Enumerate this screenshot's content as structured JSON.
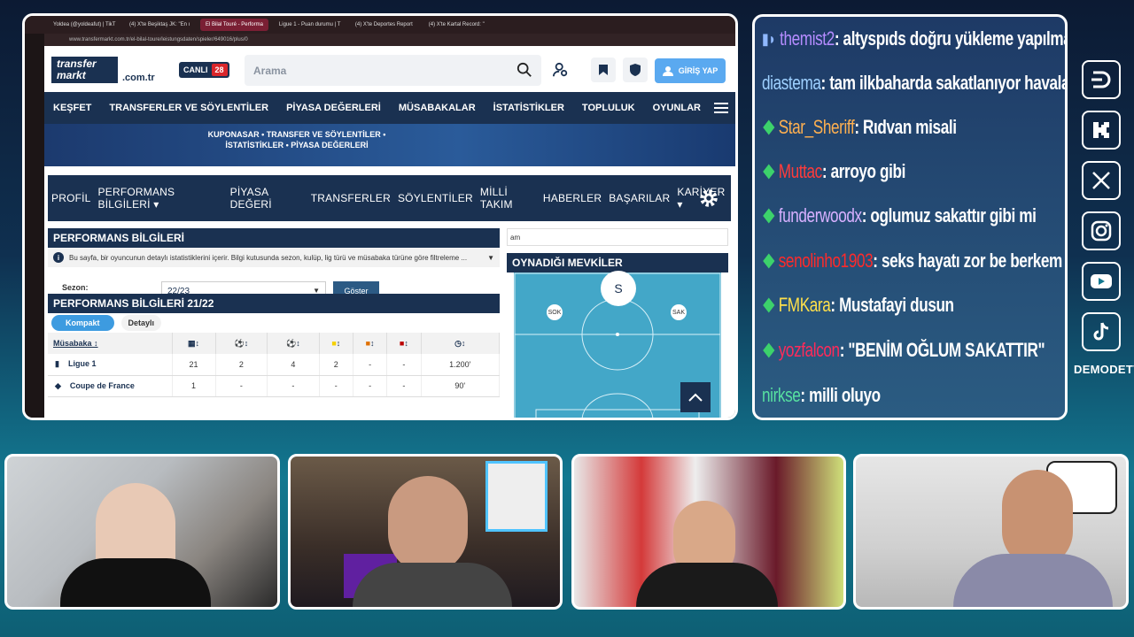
{
  "browser": {
    "tabs": [
      "Yoldea (@yoldeafut) | TikT",
      "(4) X'te Beşiktaş JK: \"En ı",
      "El Bilal Touré - Performa",
      "Ligue 1 - Puan durumu | T",
      "(4) X'te Deportes Report",
      "(4) X'te Kartal Record: \""
    ],
    "url": "www.transfermarkt.com.tr/el-bilal-toure/leistungsdaten/spieler/649016/plus/0"
  },
  "site": {
    "logo_line1": "transfer",
    "logo_line2": "markt",
    "logo_suffix": ".com.tr",
    "canli_label": "CANLI",
    "canli_count": "28",
    "search_placeholder": "Arama",
    "login_label": "GİRİŞ YAP",
    "nav": [
      "KEŞFET",
      "TRANSFERLER VE SÖYLENTİLER",
      "PİYASA DEĞERLERİ",
      "MÜSABAKALAR",
      "İSTATİSTİKLER",
      "TOPLULUK",
      "OYUNLAR"
    ],
    "banner_text": "KUPONASAR • TRANSFER VE SÖYLENTİLER • İSTATİSTİKLER • PİYASA DEĞERLERİ",
    "subnav": [
      "PROFİL",
      "PERFORMANS BİLGİLERİ ▾",
      "PİYASA DEĞERİ",
      "TRANSFERLER",
      "SÖYLENTİLER",
      "MİLLİ TAKIM",
      "HABERLER",
      "BAŞARILAR",
      "KARİYER ▾"
    ],
    "perf_title": "PERFORMANS BİLGİLERİ",
    "info_text": "Bu sayfa, bir oyuncunun detaylı istatistiklerini içerir. Bilgi kutusunda sezon, kulüp, lig türü ve müsabaka türüne göre filtreleme ...",
    "sezon_label": "Sezon:",
    "sezon_value": "22/23",
    "goster_label": "Göster",
    "perf_title2": "PERFORMANS BİLGİLERİ 21/22",
    "tab_kompakt": "Kompakt",
    "tab_detayli": "Detaylı",
    "table_header_first": "Müsabaka",
    "rows": [
      {
        "comp": "Ligue 1",
        "c1": "21",
        "c2": "2",
        "c3": "4",
        "c4": "2",
        "c5": "-",
        "c6": "-",
        "c7": "1.200'"
      },
      {
        "comp": "Coupe de France",
        "c1": "1",
        "c2": "-",
        "c3": "-",
        "c4": "-",
        "c5": "-",
        "c6": "-",
        "c7": "90'"
      }
    ],
    "minibox_text": "am",
    "position_title": "OYNADIĞI MEVKİLER",
    "pos_main": "S",
    "pos_left": "SOK",
    "pos_right": "SAK"
  },
  "chat": [
    {
      "user": "themist2",
      "color": "#b58cff",
      "text": ": altyspıds doğru yükleme yapılmamıştır",
      "badge": "ds"
    },
    {
      "user": "diastema",
      "color": "#9ed0ff",
      "text": ": tam ilkbaharda sakatlanıyor havalar ısınıyo",
      "badge": ""
    },
    {
      "user": "Star_Sheriff",
      "color": "#ffb050",
      "text": ": Rıdvan misali",
      "badge": "dm"
    },
    {
      "user": "Muttac",
      "color": "#ff3b3b",
      "text": ": arroyo gibi",
      "badge": "dm"
    },
    {
      "user": "funderwoodx",
      "color": "#d7b0ff",
      "text": ": oglumuz sakattır gibi mi",
      "badge": "dm"
    },
    {
      "user": "senolinho1903",
      "color": "#ff2a2a",
      "text": ": seks hayatı zor be berkem",
      "badge": "dm"
    },
    {
      "user": "FMKara",
      "color": "#ffe04a",
      "text": ": Mustafayi dusun",
      "badge": "dm"
    },
    {
      "user": "yozfalcon",
      "color": "#ff2a5a",
      "text": ": \"BENİM OĞLUM SAKATTIR\"",
      "badge": "dm"
    },
    {
      "user": "nirkse",
      "color": "#57e0a0",
      "text": ": milli oluyo",
      "badge": ""
    }
  ],
  "brand": "DEMODETV",
  "socials": [
    "dlive-icon",
    "kick-icon",
    "x-icon",
    "instagram-icon",
    "youtube-icon",
    "tiktok-icon"
  ]
}
